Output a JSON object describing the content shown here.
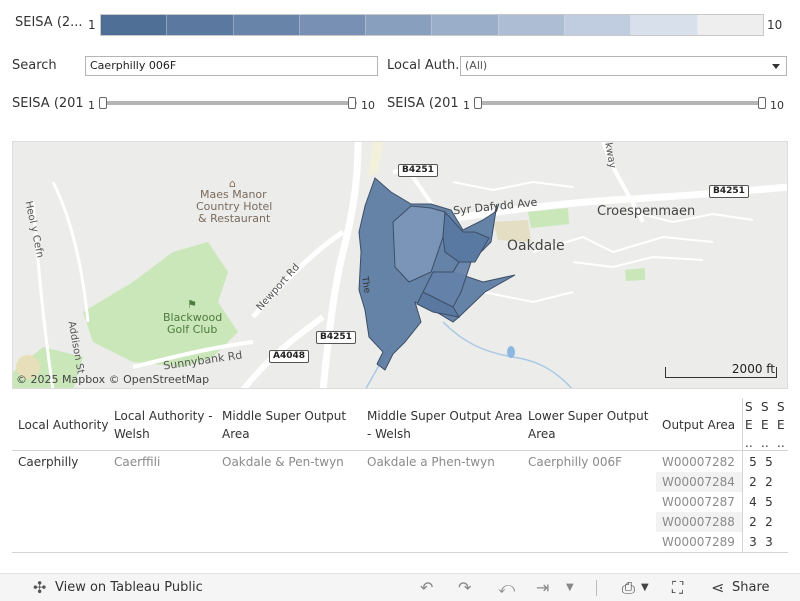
{
  "legend": {
    "title": "SEISA (2...",
    "min": "1",
    "max": "10",
    "colors": [
      "#4f6f97",
      "#5b79a0",
      "#6884a9",
      "#7790b3",
      "#889fbe",
      "#9aaec9",
      "#acbdd4",
      "#c0cde0",
      "#d8e0ec",
      "#eeeeee"
    ]
  },
  "search": {
    "label": "Search",
    "value": "Caerphilly 006F"
  },
  "local_authority_filter": {
    "label": "Local Auth...",
    "value": "(All)"
  },
  "slider1": {
    "label": "SEISA (201...",
    "min": "1",
    "max": "10"
  },
  "slider2": {
    "label": "SEISA (201...",
    "min": "1",
    "max": "10"
  },
  "map": {
    "labels": {
      "croespenmaen": "Croespenmaen",
      "oakdale": "Oakdale",
      "maes_manor": "Maes Manor",
      "country_hotel": "Country Hotel",
      "restaurant": "& Restaurant",
      "blackwood": "Blackwood",
      "golf_club": "Golf Club",
      "sunnybank": "Sunnybank Rd",
      "newport": "Newport Rd",
      "syr_dafydd": "Syr Dafydd Ave",
      "heol_y_cefn": "Heol y Cefn",
      "addison": "Addison St",
      "kway": "kway",
      "the": "The"
    },
    "roads": {
      "b4251_a": "B4251",
      "b4251_b": "B4251",
      "b4251_c": "B4251",
      "a4048": "A4048"
    },
    "attribution": "© 2025 Mapbox  © OpenStreetMap",
    "scale": "2000 ft"
  },
  "table": {
    "headers": {
      "la": "Local Authority",
      "la_welsh": "Local Authority - Welsh",
      "msoa": "Middle Super Output Area",
      "msoa_welsh": "Middle Super Output Area - Welsh",
      "lsoa": "Lower Super Output Area",
      "oa": "Output Area",
      "s1": "S E ..",
      "s2": "S E ..",
      "s3": "S E .."
    },
    "row": {
      "la": "Caerphilly",
      "la_welsh": "Caerffili",
      "msoa": "Oakdale & Pen-twyn",
      "msoa_welsh": "Oakdale a Phen-twyn",
      "lsoa": "Caerphilly 006F"
    },
    "output_areas": [
      {
        "code": "W00007282",
        "s1": "5",
        "s2": "5"
      },
      {
        "code": "W00007284",
        "s1": "2",
        "s2": "2"
      },
      {
        "code": "W00007287",
        "s1": "4",
        "s2": "5"
      },
      {
        "code": "W00007288",
        "s1": "2",
        "s2": "2"
      },
      {
        "code": "W00007289",
        "s1": "3",
        "s2": "3"
      }
    ]
  },
  "footer": {
    "view_label": "View on Tableau Public",
    "share_label": "Share"
  }
}
